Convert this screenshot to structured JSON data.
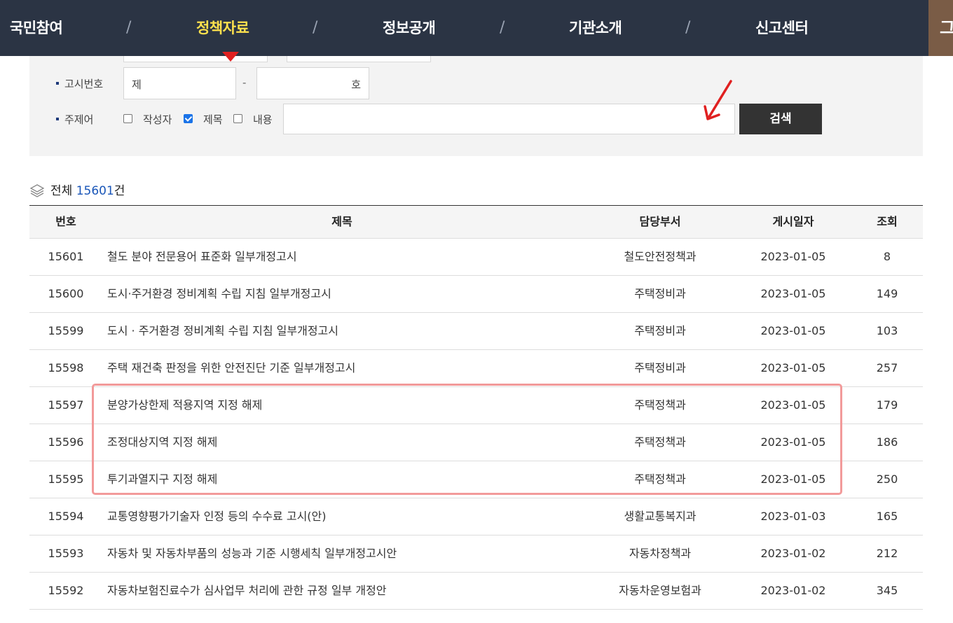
{
  "nav": {
    "items": [
      "국민참여",
      "정책자료",
      "정보공개",
      "기관소개",
      "신고센터"
    ],
    "active": "정책자료",
    "separator": "/",
    "side_label": "그"
  },
  "search": {
    "notice_label": "고시번호",
    "notice_prefix": "제",
    "notice_dash": "-",
    "notice_suffix": "호",
    "keyword_label": "주제어",
    "checkboxes": [
      {
        "label": "작성자",
        "checked": false
      },
      {
        "label": "제목",
        "checked": true
      },
      {
        "label": "내용",
        "checked": false
      }
    ],
    "keyword_value": "",
    "button_label": "검색"
  },
  "total": {
    "prefix": "전체",
    "count": "15601",
    "suffix": "건"
  },
  "table": {
    "headers": [
      "번호",
      "제목",
      "담당부서",
      "게시일자",
      "조회"
    ],
    "rows": [
      {
        "no": "15601",
        "title": "철도 분야 전문용어 표준화 일부개정고시",
        "dept": "철도안전정책과",
        "date": "2023-01-05",
        "views": "8"
      },
      {
        "no": "15600",
        "title": "도시·주거환경 정비계획 수립 지침 일부개정고시",
        "dept": "주택정비과",
        "date": "2023-01-05",
        "views": "149"
      },
      {
        "no": "15599",
        "title": "도시 · 주거환경 정비계획 수립 지침 일부개정고시",
        "dept": "주택정비과",
        "date": "2023-01-05",
        "views": "103"
      },
      {
        "no": "15598",
        "title": "주택 재건축 판정을 위한 안전진단 기준 일부개정고시",
        "dept": "주택정비과",
        "date": "2023-01-05",
        "views": "257"
      },
      {
        "no": "15597",
        "title": "분양가상한제 적용지역 지정 해제",
        "dept": "주택정책과",
        "date": "2023-01-05",
        "views": "179"
      },
      {
        "no": "15596",
        "title": "조정대상지역 지정 해제",
        "dept": "주택정책과",
        "date": "2023-01-05",
        "views": "186"
      },
      {
        "no": "15595",
        "title": "투기과열지구 지정 해제",
        "dept": "주택정책과",
        "date": "2023-01-05",
        "views": "250"
      },
      {
        "no": "15594",
        "title": "교통영향평가기술자 인정 등의 수수료 고시(안)",
        "dept": "생활교통복지과",
        "date": "2023-01-03",
        "views": "165"
      },
      {
        "no": "15593",
        "title": "자동차 및 자동차부품의 성능과 기준 시행세칙 일부개정고시안",
        "dept": "자동차정책과",
        "date": "2023-01-02",
        "views": "212"
      },
      {
        "no": "15592",
        "title": "자동차보험진료수가 심사업무 처리에 관한 규정 일부 개정안",
        "dept": "자동차운영보험과",
        "date": "2023-01-02",
        "views": "345"
      }
    ]
  },
  "colors": {
    "nav_bg": "#2b3444",
    "nav_active": "#ffe14d",
    "accent_count": "#1a56b8",
    "highlight": "#f29a9a",
    "arrow": "#e02020"
  }
}
